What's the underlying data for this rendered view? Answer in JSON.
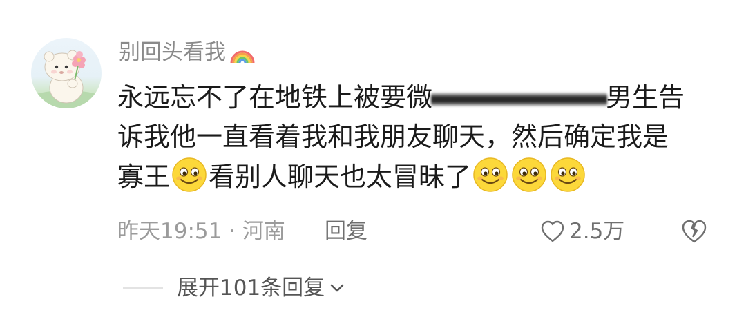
{
  "comment": {
    "username": "别回头看我",
    "username_badge_icon": "rainbow-icon",
    "avatar_icon": "bear-holding-flower-avatar",
    "text_lines": {
      "line1_start": "永远忘不了在地铁上被要微",
      "line1_end": "男生告",
      "line2": "诉我他一直看着我和我朋友聊天，然后确定我是",
      "line3_a": "寡王",
      "line3_b": "看别人聊天也太冒昧了"
    },
    "emoji_icon": "grinning-face-emoji",
    "emoji_count_end": 3,
    "timestamp": "昨天19:51",
    "separator": " · ",
    "location": "河南",
    "reply_label": "回复",
    "like_count": "2.5万",
    "like_icon": "heart-outline-icon",
    "dislike_icon": "broken-heart-icon"
  },
  "replies": {
    "expand_label": "展开101条回复",
    "expand_icon": "chevron-down-icon"
  },
  "colors": {
    "username": "#8a8a8a",
    "body_text": "#1a1a1a",
    "meta_text": "#9b9b9b",
    "action_text": "#6f6f6f",
    "expand_text": "#555555",
    "emoji_yellow": "#fcd83a"
  }
}
